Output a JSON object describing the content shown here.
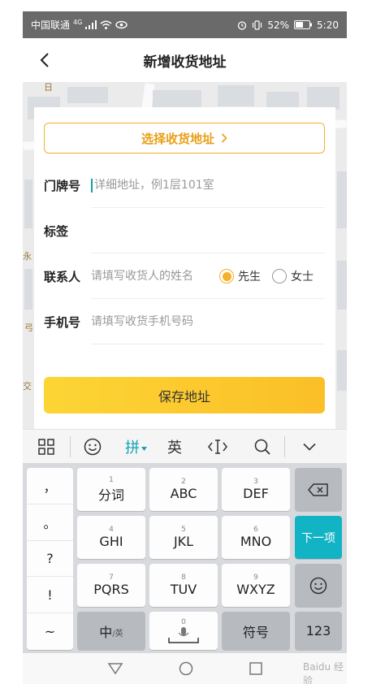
{
  "status_bar": {
    "carrier": "中国联通",
    "network": "4G",
    "battery": "52%",
    "time": "5:20"
  },
  "header": {
    "title": "新增收货地址"
  },
  "form": {
    "select_address_label": "选择收货地址",
    "door_label": "门牌号",
    "door_placeholder": "详细地址，例1层101室",
    "tag_label": "标签",
    "contact_label": "联系人",
    "contact_placeholder": "请填写收货人的姓名",
    "gender_male": "先生",
    "gender_female": "女士",
    "gender_selected": "先生",
    "phone_label": "手机号",
    "phone_placeholder": "请填写收货手机号码",
    "save_label": "保存地址"
  },
  "map": {
    "labels": [
      "日",
      "永",
      "弓",
      "交"
    ]
  },
  "keyboard": {
    "toolbar": {
      "pinyin": "拼",
      "english": "英"
    },
    "side_keys": [
      "，",
      "。",
      "?",
      "!",
      "~"
    ],
    "keys": [
      {
        "num": "1",
        "label": "分词"
      },
      {
        "num": "2",
        "label": "ABC"
      },
      {
        "num": "3",
        "label": "DEF"
      },
      {
        "num": "4",
        "label": "GHI"
      },
      {
        "num": "5",
        "label": "JKL"
      },
      {
        "num": "6",
        "label": "MNO"
      },
      {
        "num": "7",
        "label": "PQRS"
      },
      {
        "num": "8",
        "label": "TUV"
      },
      {
        "num": "9",
        "label": "WXYZ"
      }
    ],
    "next_label": "下一项",
    "lang_switch": "中",
    "lang_switch_sub": "/英",
    "space_num": "0",
    "symbols_label": "符号",
    "numbers_label": "123"
  },
  "watermark": "Baidu 经验"
}
